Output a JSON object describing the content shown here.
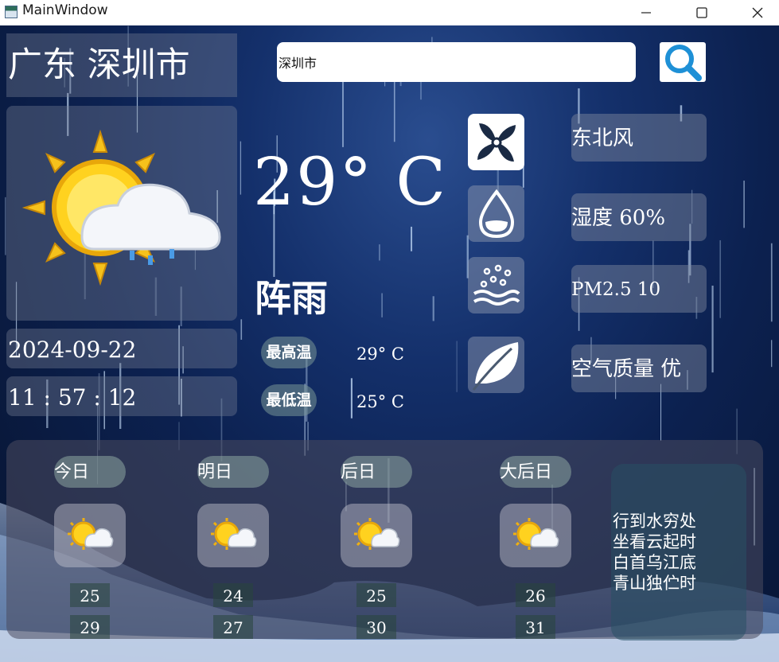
{
  "window": {
    "title": "MainWindow"
  },
  "location": {
    "city": "广东 深圳市"
  },
  "search": {
    "value": "深圳市"
  },
  "datetime": {
    "date": "2024-09-22",
    "time": "11 : 57 : 12"
  },
  "current": {
    "temperature": "29° C",
    "condition": "阵雨",
    "high_label": "最高温",
    "high_value": "29° C",
    "low_label": "最低温",
    "low_value": "25° C",
    "icon": "sun-cloud-rain-icon"
  },
  "details": {
    "wind": "东北风",
    "humidity": "湿度 60%",
    "pm25": "PM2.5 10",
    "air_quality": "空气质量 优"
  },
  "forecast": [
    {
      "label": "今日",
      "low": "25",
      "high": "29"
    },
    {
      "label": "明日",
      "low": "24",
      "high": "27"
    },
    {
      "label": "后日",
      "low": "25",
      "high": "30"
    },
    {
      "label": "大后日",
      "low": "26",
      "high": "31"
    }
  ],
  "poem": [
    "行到水穷处",
    "坐看云起时",
    "白首乌江底",
    "青山独伫时"
  ],
  "colors": {
    "accent_search": "#1e90d6",
    "background": "#0c2150"
  }
}
